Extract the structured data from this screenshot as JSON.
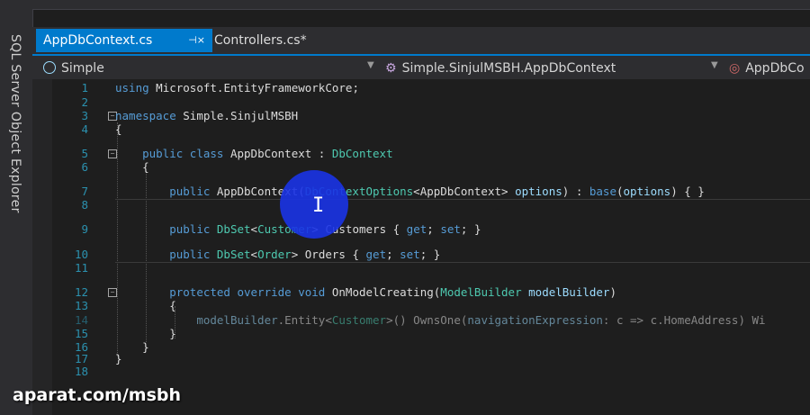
{
  "sidebar": {
    "label": "SQL Server Object Explorer"
  },
  "tabs": [
    {
      "label": "AppDbContext.cs",
      "pin": "⊣×"
    },
    {
      "label": "Controllers.cs*"
    }
  ],
  "navbar": {
    "project": "Simple",
    "class": "Simple.SinjulMSBH.AppDbContext",
    "member": "AppDbCo"
  },
  "lines": [
    {
      "n": "1",
      "code": "using Microsoft.EntityFrameworkCore;"
    },
    {
      "n": "2",
      "code": ""
    },
    {
      "n": "3",
      "code": "namespace Simple.SinjulMSBH"
    },
    {
      "n": "4",
      "code": "{"
    },
    {
      "n": "5",
      "code": "    public class AppDbContext : DbContext"
    },
    {
      "n": "6",
      "code": "    {"
    },
    {
      "n": "7",
      "code": "        public AppDbContext(DbContextOptions<AppDbContext> options) : base(options) { }"
    },
    {
      "n": "8",
      "code": ""
    },
    {
      "n": "9",
      "code": "        public DbSet<Customer> Customers { get; set; }"
    },
    {
      "n": "10",
      "code": "        public DbSet<Order> Orders { get; set; }"
    },
    {
      "n": "11",
      "code": ""
    },
    {
      "n": "12",
      "code": "        protected override void OnModelCreating(ModelBuilder modelBuilder)"
    },
    {
      "n": "13",
      "code": "        {"
    },
    {
      "n": "14",
      "code": "            modelBuilder.Entity<Customer>() OwnsOne(navigationExpression: c => c.HomeAddress) Wi"
    },
    {
      "n": "15",
      "code": "        }"
    },
    {
      "n": "16",
      "code": "    }"
    },
    {
      "n": "17",
      "code": "}"
    },
    {
      "n": "18",
      "code": ""
    }
  ],
  "watermark": "aparat.com/msbh"
}
